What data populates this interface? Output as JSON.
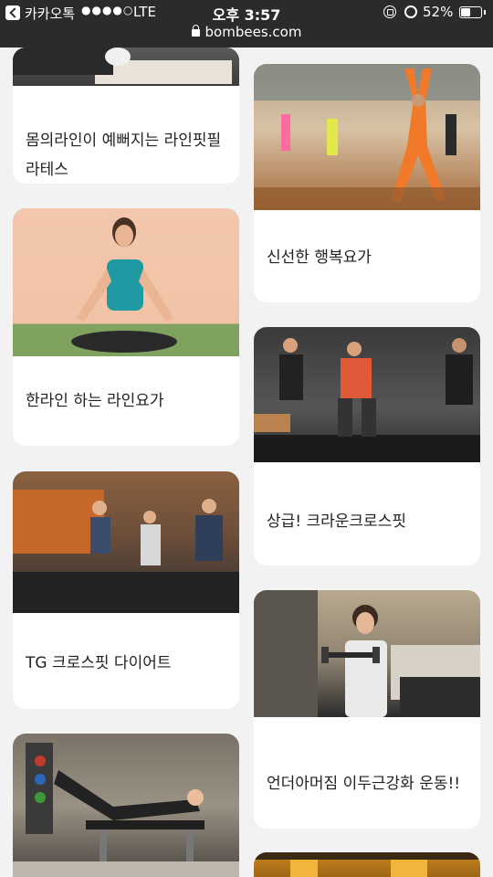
{
  "status_bar": {
    "carrier": "카카오톡",
    "signal": "●●●●○",
    "network": "LTE",
    "time": "오후 3:57",
    "battery": "52%",
    "battery_level": 0.52
  },
  "address_bar": {
    "domain": "bombees.com"
  },
  "cards": [
    {
      "title": "몸의라인이 예뻐지는 라인핏필라테스",
      "image": "pilates-floor-photo"
    },
    {
      "title": "신선한 행복요가",
      "image": "yoga-class-photo"
    },
    {
      "title": "한라인 하는 라인요가",
      "image": "meditation-photo"
    },
    {
      "title": "상급! 크라운크로스핏",
      "image": "crossfit-class-photo"
    },
    {
      "title": "TG 크로스핏 다이어트",
      "image": "piggyback-training-photo"
    },
    {
      "title": "언더아머짐 이두근강화 운동!!",
      "image": "bicep-curl-photo"
    },
    {
      "image": "bench-exercise-photo"
    },
    {
      "image": "gym-interior-photo"
    }
  ]
}
